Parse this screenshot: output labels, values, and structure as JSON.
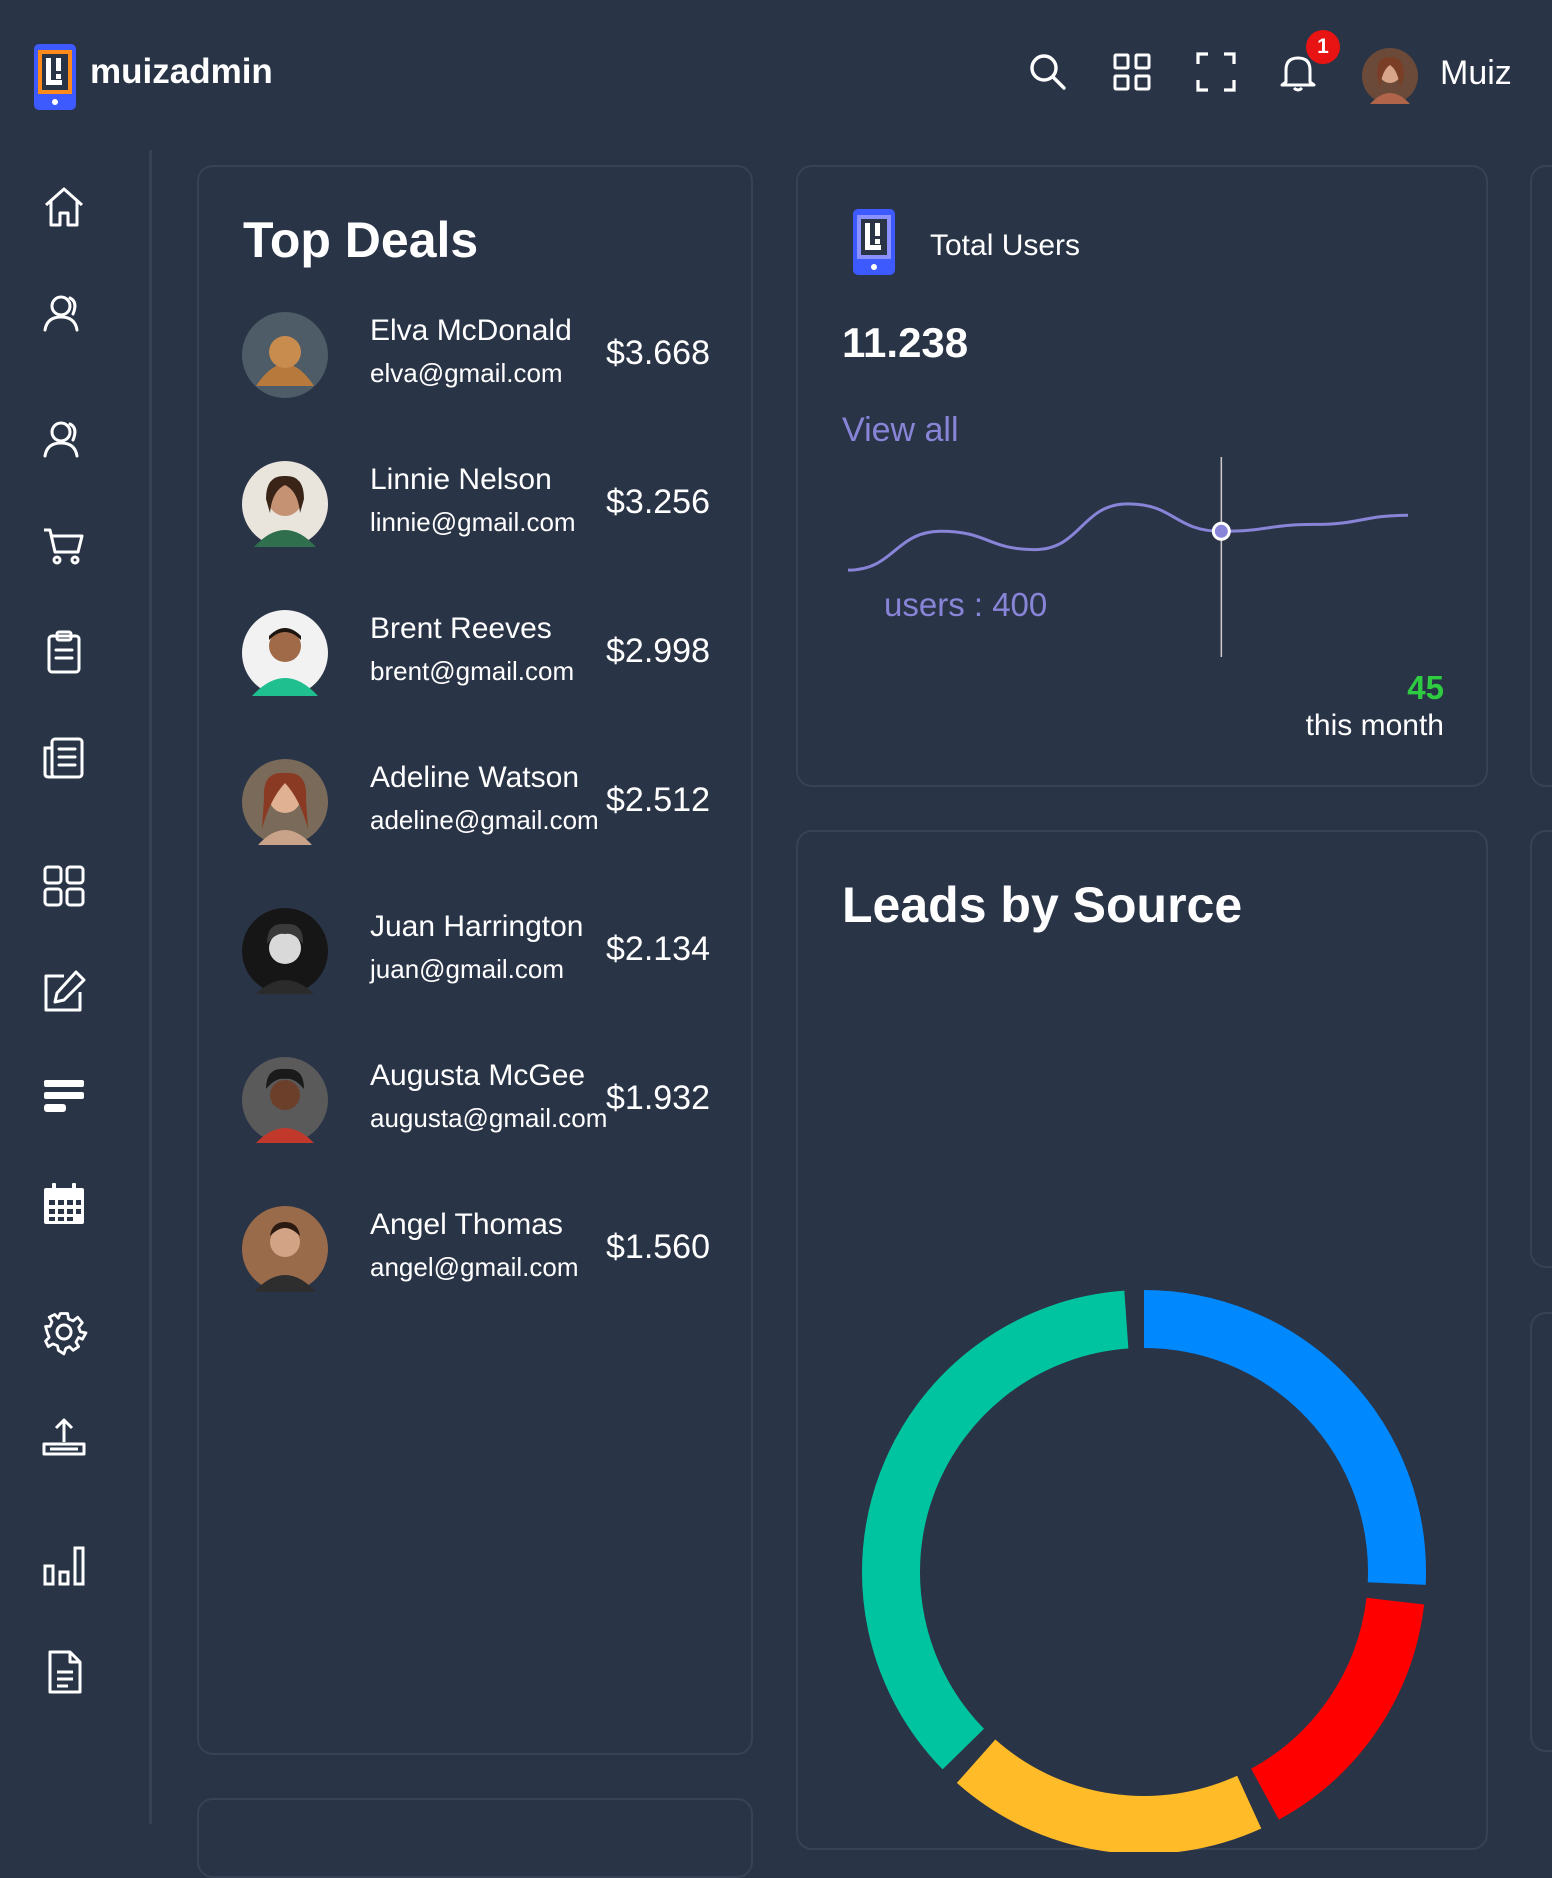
{
  "brand": {
    "name": "muizadmin",
    "logo_icon": "app-logo-icon"
  },
  "topbar": {
    "icons": [
      "search-icon",
      "apps-grid-icon",
      "fullscreen-icon",
      "notification-bell-icon"
    ],
    "notification_count": "1",
    "user_name": "Muiz"
  },
  "sidebar": {
    "items": [
      "home-icon",
      "profile-icon",
      "users-icon",
      "cart-icon",
      "clipboard-icon",
      "news-icon",
      "grid-icon",
      "edit-icon",
      "list-icon",
      "calendar-icon",
      "settings-icon",
      "upload-icon",
      "chart-icon",
      "document-icon"
    ]
  },
  "top_deals": {
    "title": "Top Deals",
    "rows": [
      {
        "name": "Elva McDonald",
        "email": "elva@gmail.com",
        "amount": "$3.668"
      },
      {
        "name": "Linnie Nelson",
        "email": "linnie@gmail.com",
        "amount": "$3.256"
      },
      {
        "name": "Brent Reeves",
        "email": "brent@gmail.com",
        "amount": "$2.998"
      },
      {
        "name": "Adeline Watson",
        "email": "adeline@gmail.com",
        "amount": "$2.512"
      },
      {
        "name": "Juan Harrington",
        "email": "juan@gmail.com",
        "amount": "$2.134"
      },
      {
        "name": "Augusta McGee",
        "email": "augusta@gmail.com",
        "amount": "$1.932"
      },
      {
        "name": "Angel Thomas",
        "email": "angel@gmail.com",
        "amount": "$1.560"
      }
    ]
  },
  "total_users": {
    "title": "Total Users",
    "value": "11.238",
    "link": "View all",
    "tooltip": "users : 400",
    "percent": "45",
    "period": "this month",
    "line_color": "#8884d8",
    "series_values": [
      230,
      400,
      320,
      520,
      400,
      430,
      470
    ]
  },
  "leads": {
    "title": "Leads by Source",
    "colors": [
      "#0088FE",
      "#FF0000",
      "#FFBB28",
      "#00C49F"
    ],
    "segment_values": [
      24.5,
      14.5,
      17.5,
      34.5
    ]
  },
  "chart_data": [
    {
      "type": "line",
      "title": "Total Users",
      "series": [
        {
          "values": [
            230,
            400,
            320,
            520,
            400,
            430,
            470
          ]
        }
      ],
      "annotations": [
        "users : 400"
      ]
    },
    {
      "type": "pie",
      "title": "Leads by Source",
      "values": [
        24.5,
        14.5,
        17.5,
        34.5
      ],
      "colors": [
        "#0088FE",
        "#FF0000",
        "#FFBB28",
        "#00C49F"
      ]
    }
  ]
}
